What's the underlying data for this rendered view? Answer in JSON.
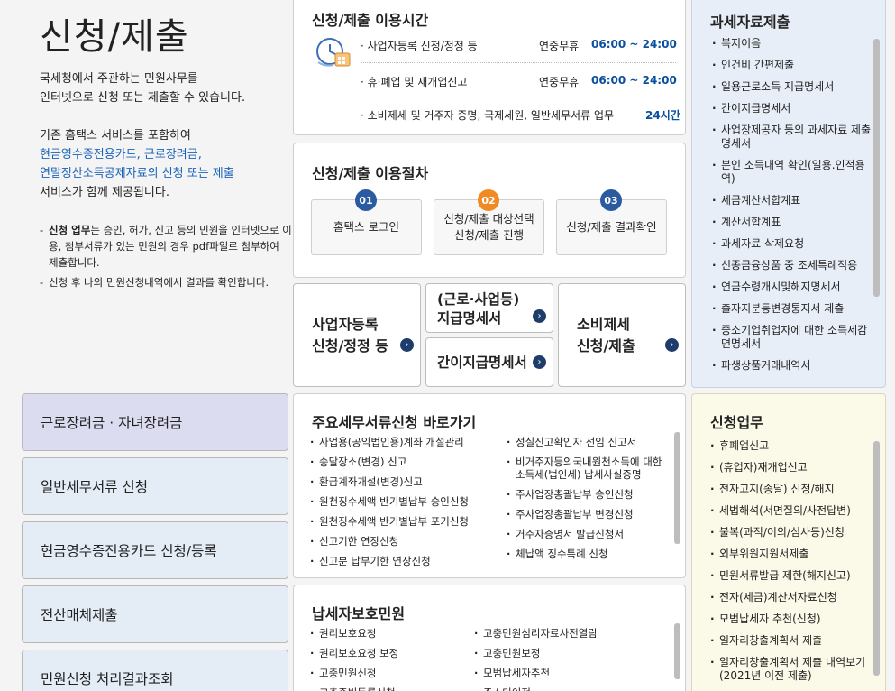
{
  "page": {
    "title": "신청/제출",
    "intro_lines": [
      "국세청에서 주관하는 민원사무를",
      "인터넷으로 신청 또는 제출할 수 있습니다."
    ],
    "intro2_line1": "기존 홈택스 서비스를 포함하여",
    "intro2_blue": [
      "현금영수증전용카드, 근로장려금,",
      "연말정산소득공제자료의 신청 또는 제출"
    ],
    "intro2_last": "서비스가 함께 제공됩니다.",
    "notes": [
      {
        "bold": "신청 업무",
        "text": "는 승인, 허가, 신고 등의 민원을 인터넷으로 이용, 첨부서류가 있는 민원의 경우 pdf파일로 첨부하여 제출합니다."
      },
      {
        "bold": "",
        "text": "신청 후 나의 민원신청내역에서 결과를 확인합니다."
      }
    ]
  },
  "hours": {
    "title": "신청/제출 이용시간",
    "icon": "clock-calendar-icon",
    "rows": [
      {
        "label": "· 사업자등록 신청/정정 등",
        "status": "연중무휴",
        "time": "06:00 ~ 24:00"
      },
      {
        "label": "· 휴·폐업 및 재개업신고",
        "status": "연중무휴",
        "time": "06:00 ~ 24:00"
      },
      {
        "label": "· 소비제세 및 거주자 증명, 국제세원, 일반세무서류 업무",
        "status": "",
        "time": "24시간"
      }
    ]
  },
  "process": {
    "title": "신청/제출 이용절차",
    "steps": [
      {
        "num": "01",
        "label": "홈택스 로그인",
        "color": "#2a5aa0"
      },
      {
        "num": "02",
        "label_1": "신청/제출 대상선택",
        "label_2": "신청/제출 진행",
        "color": "#f08a24"
      },
      {
        "num": "03",
        "label": "신청/제출 결과확인",
        "color": "#2a5aa0"
      }
    ]
  },
  "quick": {
    "biz_1": "사업자등록",
    "biz_2": "신청/정정 등",
    "wage_1": "(근로·사업등)",
    "wage_2": "지급명세서",
    "simple": "간이지급명세서",
    "cons_1": "소비제세",
    "cons_2": "신청/제출"
  },
  "tax_data": {
    "title": "과세자료제출",
    "items": [
      "복지이음",
      "인건비 간편제출",
      "일용근로소득 지급명세서",
      "간이지급명세서",
      "사업장제공자 등의 과세자료 제출명세서",
      "본인 소득내역 확인(일용.인적용역)",
      "세금계산서합계표",
      "계산서합계표",
      "과세자료 삭제요청",
      "신종금융상품 중 조세특례적용",
      "연금수령개시및해지명세서",
      "출자지분등변경통지서 제출",
      "중소기업취업자에 대한 소득세감면명세서",
      "파생상품거래내역서"
    ]
  },
  "nav": [
    "근로장려금 · 자녀장려금",
    "일반세무서류 신청",
    "현금영수증전용카드 신청/등록",
    "전산매체제출",
    "민원신청 처리결과조회"
  ],
  "major": {
    "title": "주요세무서류신청 바로가기",
    "left": [
      "사업용(공익법인용)계좌 개설관리",
      "송달장소(변경) 신고",
      "환급계좌개설(변경)신고",
      "원천징수세액 반기별납부 승인신청",
      "원천징수세액 반기별납부 포기신청",
      "신고기한 연장신청",
      "신고분 납부기한 연장신청"
    ],
    "right": [
      "성실신고확인자 선임 신고서",
      "비거주자등의국내원천소득에 대한 소득세(법인세) 납세사실증명",
      "주사업장총괄납부 승인신청",
      "주사업장총괄납부 변경신청",
      "거주자증명서 발급신청서",
      "체납액 징수특례 신청"
    ]
  },
  "protect": {
    "title": "납세자보호민원",
    "left": [
      "권리보호요청",
      "권리보호요청 보정",
      "고충민원신청",
      "고충증빙등록신청"
    ],
    "right": [
      "고충민원심리자료사전열람",
      "고충민원보정",
      "모범납세자추천",
      "주소미이전"
    ]
  },
  "apply": {
    "title": "신청업무",
    "items": [
      "휴폐업신고",
      "(휴업자)재개업신고",
      "전자고지(송달) 신청/해지",
      "세법해석(서면질의/사전답변)",
      "불복(과적/이의/심사등)신청",
      "외부위원지원서제출",
      "민원서류발급 제한(해지신고)",
      "전자(세금)계산서자료신청",
      "모범납세자 추천(신청)",
      "일자리창출계획서 제출",
      "일자리창출계획서 제출 내역보기(2021년 이전 제출)"
    ]
  },
  "colors": {
    "accent_blue": "#0b4fa0",
    "step_orange": "#f08a24",
    "nav_purple": "#dcdcf0",
    "nav_blue": "#e4ecf6",
    "side_blue": "#e8eef7",
    "side_cream": "#fbf9e8"
  }
}
